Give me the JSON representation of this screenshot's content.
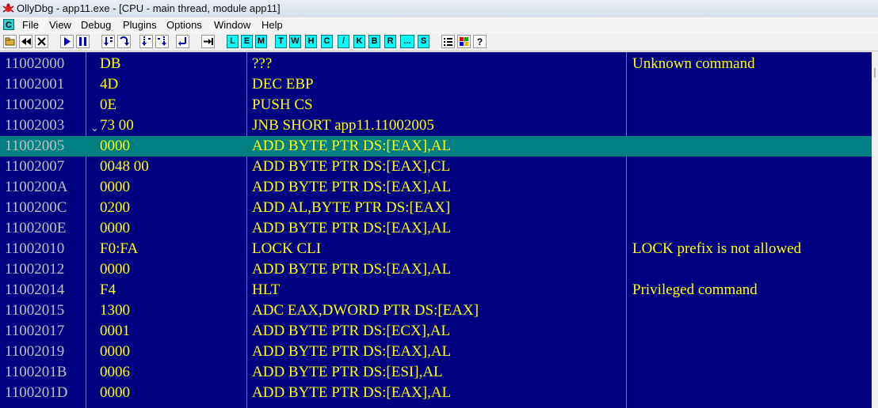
{
  "window": {
    "title": "OllyDbg - app11.exe - [CPU - main thread, module app11]",
    "icon": "bug-icon"
  },
  "menu": {
    "icon_letter": "C",
    "items": [
      "File",
      "View",
      "Debug",
      "Plugins",
      "Options",
      "Window",
      "Help"
    ]
  },
  "toolbar": {
    "icons": [
      "open-icon",
      "rewind-icon",
      "close-icon",
      "run-icon",
      "pause-icon",
      "step-into-icon",
      "step-over-icon",
      "trace-into-icon",
      "trace-over-icon",
      "execute-till-return-icon",
      "goto-icon"
    ],
    "letters": [
      "L",
      "E",
      "M",
      "T",
      "W",
      "H",
      "C",
      "/",
      "K",
      "B",
      "R",
      "...",
      "S"
    ],
    "right_icons": [
      "list-icon",
      "colors-icon",
      "help-icon"
    ]
  },
  "disasm": {
    "rows": [
      {
        "addr": "11002000",
        "hex": "DB",
        "dis": "???",
        "comment": "Unknown command"
      },
      {
        "addr": "11002001",
        "hex": "4D",
        "dis": "DEC EBP",
        "comment": ""
      },
      {
        "addr": "11002002",
        "hex": "0E",
        "dis": "PUSH CS",
        "comment": ""
      },
      {
        "addr": "11002003",
        "hex": "73 00",
        "dis": "JNB SHORT app11.11002005",
        "comment": "",
        "jump": "⌄"
      },
      {
        "addr": "11002005",
        "hex": "0000",
        "dis": "ADD BYTE PTR DS:[EAX],AL",
        "comment": "",
        "selected": true
      },
      {
        "addr": "11002007",
        "hex": "0048 00",
        "dis": "ADD BYTE PTR DS:[EAX],CL",
        "comment": ""
      },
      {
        "addr": "1100200A",
        "hex": "0000",
        "dis": "ADD BYTE PTR DS:[EAX],AL",
        "comment": ""
      },
      {
        "addr": "1100200C",
        "hex": "0200",
        "dis": "ADD AL,BYTE PTR DS:[EAX]",
        "comment": ""
      },
      {
        "addr": "1100200E",
        "hex": "0000",
        "dis": "ADD BYTE PTR DS:[EAX],AL",
        "comment": ""
      },
      {
        "addr": "11002010",
        "hex": "F0:FA",
        "dis": "LOCK CLI",
        "comment": "LOCK prefix is not allowed"
      },
      {
        "addr": "11002012",
        "hex": "0000",
        "dis": "ADD BYTE PTR DS:[EAX],AL",
        "comment": ""
      },
      {
        "addr": "11002014",
        "hex": "F4",
        "dis": "HLT",
        "comment": "Privileged command"
      },
      {
        "addr": "11002015",
        "hex": "1300",
        "dis": "ADC EAX,DWORD PTR DS:[EAX]",
        "comment": ""
      },
      {
        "addr": "11002017",
        "hex": "0001",
        "dis": "ADD BYTE PTR DS:[ECX],AL",
        "comment": ""
      },
      {
        "addr": "11002019",
        "hex": "0000",
        "dis": "ADD BYTE PTR DS:[EAX],AL",
        "comment": ""
      },
      {
        "addr": "1100201B",
        "hex": "0006",
        "dis": "ADD BYTE PTR DS:[ESI],AL",
        "comment": ""
      },
      {
        "addr": "1100201D",
        "hex": "0000",
        "dis": "ADD BYTE PTR DS:[EAX],AL",
        "comment": ""
      }
    ]
  },
  "colors": {
    "pane_bg": "#000080",
    "selected_bg": "#008080",
    "code_text": "#ffff00",
    "address_text": "#c0c0c0"
  }
}
